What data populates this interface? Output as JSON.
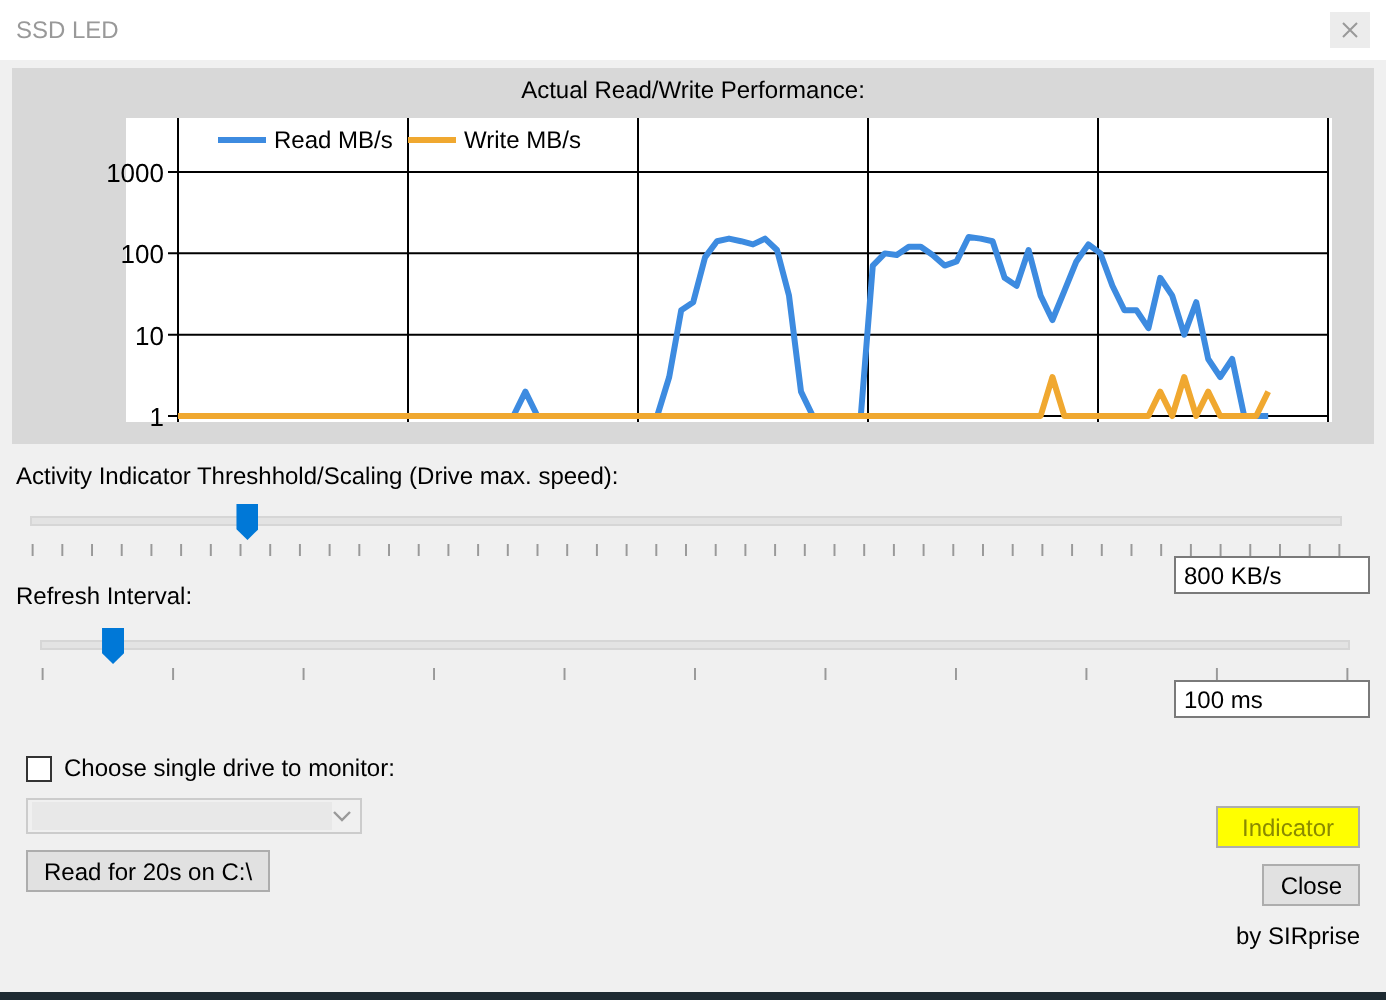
{
  "window": {
    "title": "SSD LED",
    "close_disabled": true
  },
  "performance": {
    "title": "Actual Read/Write Performance:",
    "y_axis_labels": [
      "1000",
      "100",
      "10",
      "1"
    ],
    "legend": [
      {
        "name": "Read MB/s",
        "color": "#3d8be0"
      },
      {
        "name": "Write MB/s",
        "color": "#f0a830"
      }
    ]
  },
  "threshold": {
    "label": "Activity Indicator Threshhold/Scaling (Drive max. speed):",
    "level": 0.165,
    "value": "800 KB/s"
  },
  "refresh": {
    "label": "Refresh Interval:",
    "level": 0.055,
    "value": "100 ms"
  },
  "drive": {
    "label": "Choose single drive to monitor:",
    "checked": false,
    "dropdown_disabled": true
  },
  "buttons": {
    "read": "Read for 20s on C:\\",
    "indicator": "Indicator",
    "close": "Close"
  },
  "credit": "by SIRprise"
}
